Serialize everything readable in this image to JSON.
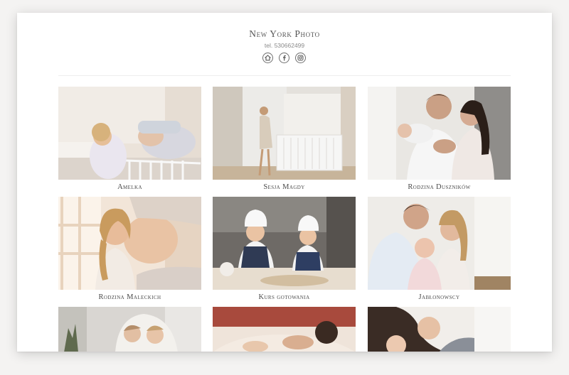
{
  "site": {
    "title": "New York Photo",
    "phone": "tel. 530662499"
  },
  "social": [
    {
      "icon": "home-icon"
    },
    {
      "icon": "facebook-icon"
    },
    {
      "icon": "instagram-icon"
    }
  ],
  "gallery": [
    {
      "caption": "Amelka"
    },
    {
      "caption": "Sesja Magdy"
    },
    {
      "caption": "Rodzina Duszników"
    },
    {
      "caption": "Rodzina Maleckich"
    },
    {
      "caption": "Kurs gotowania"
    },
    {
      "caption": "Jabłonowscy"
    },
    {
      "caption": ""
    },
    {
      "caption": ""
    },
    {
      "caption": ""
    }
  ],
  "colors": {
    "background": "#f4f3f2",
    "card": "#ffffff",
    "text": "#555555"
  }
}
